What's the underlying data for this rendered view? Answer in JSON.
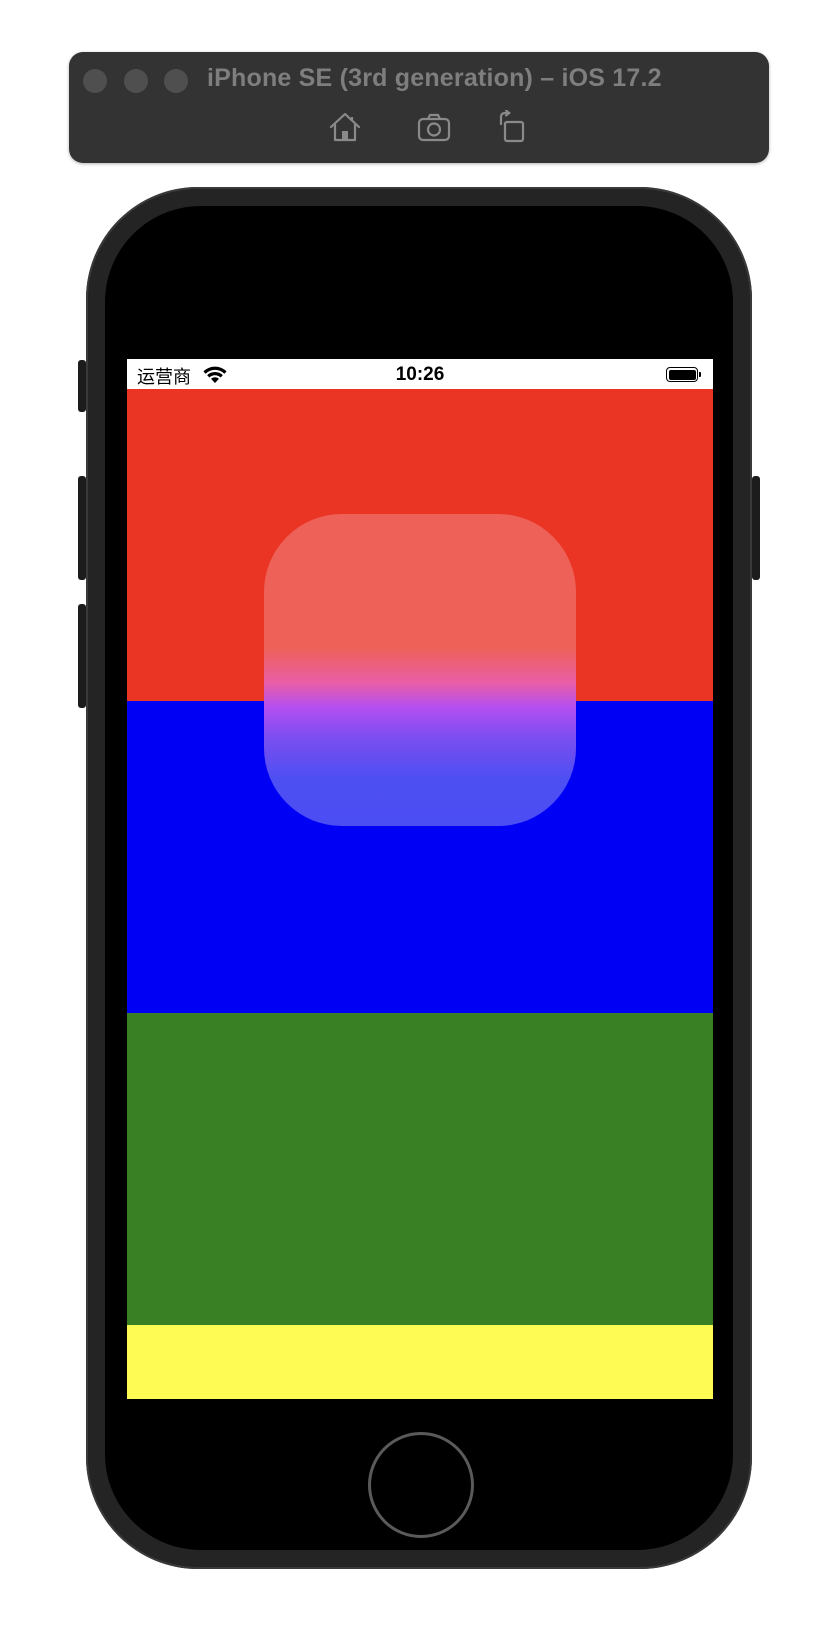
{
  "simulator": {
    "title": "iPhone SE (3rd generation) – iOS 17.2",
    "toolbar": {
      "home_icon": "home-icon",
      "screenshot_icon": "camera-icon",
      "rotate_icon": "rotate-icon"
    }
  },
  "status_bar": {
    "carrier": "运营商",
    "time": "10:26",
    "wifi_icon": "wifi-icon",
    "battery_icon": "battery-icon"
  },
  "screen": {
    "bands": [
      {
        "name": "red",
        "color": "#ea3524"
      },
      {
        "name": "blue",
        "color": "#0000f5"
      },
      {
        "name": "green",
        "color": "#397f23"
      },
      {
        "name": "yellow",
        "color": "#fefc54"
      }
    ],
    "card": {
      "top_color": "#ee6159",
      "bottom_color": "#4b4ef3"
    }
  }
}
